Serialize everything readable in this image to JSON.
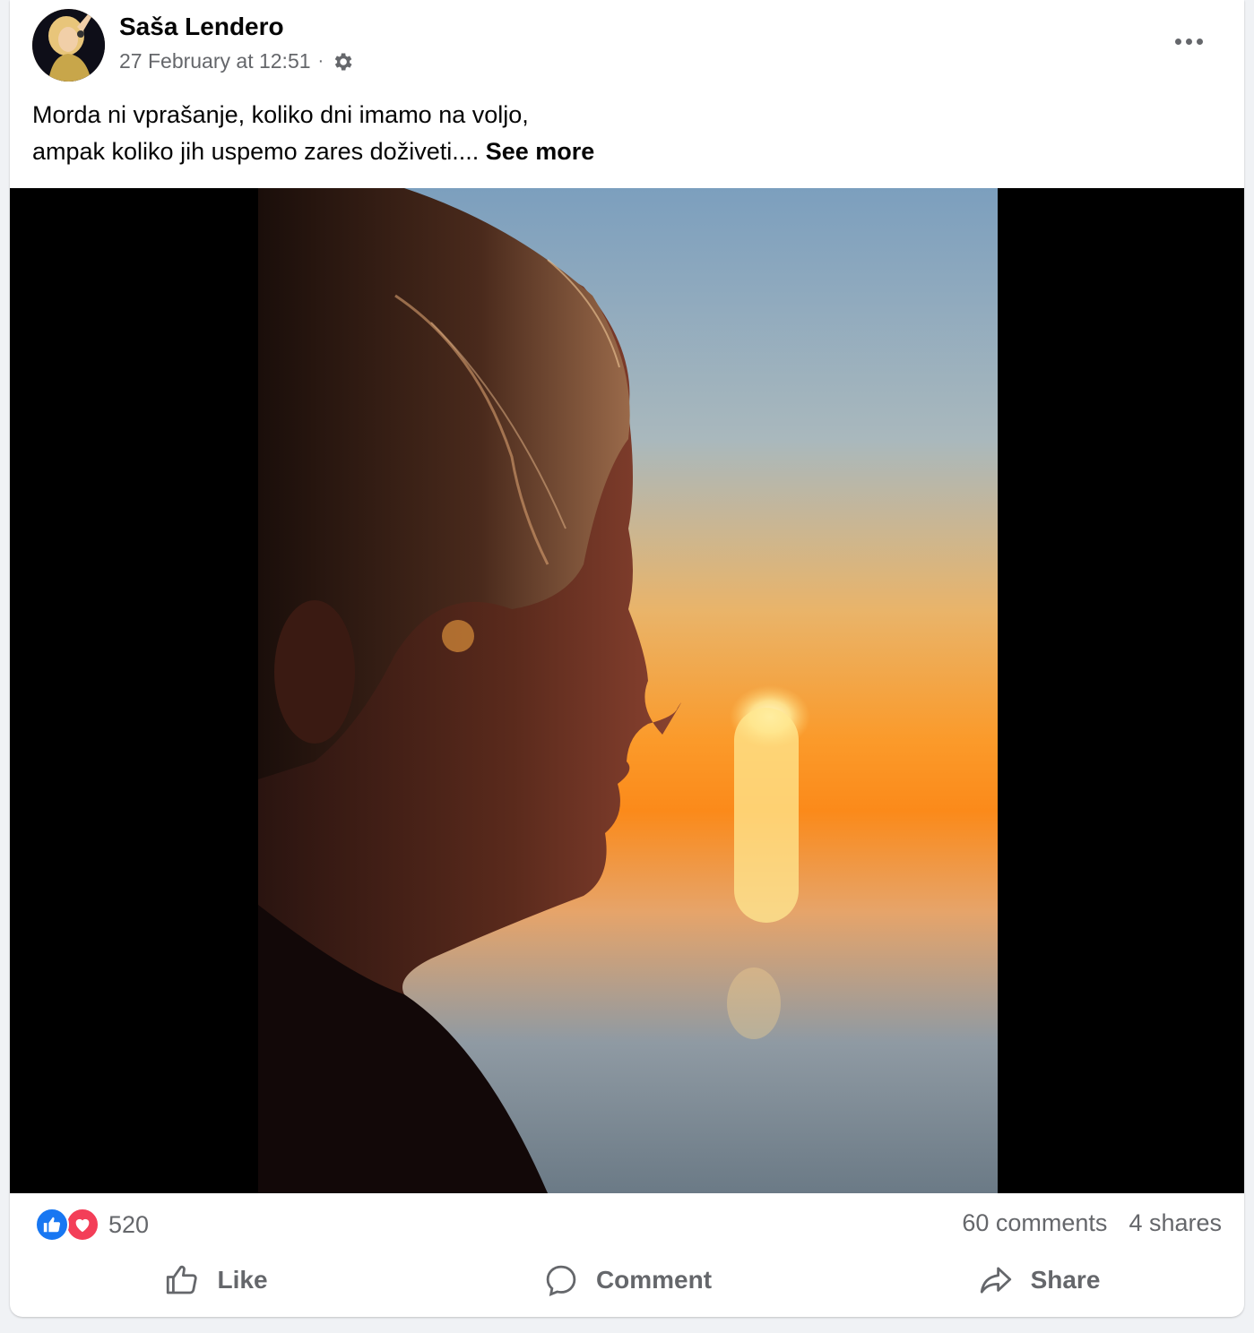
{
  "post": {
    "author": "Saša Lendero",
    "timestamp": "27 February at 12:51",
    "separator": "·",
    "privacy_icon": "gear-icon",
    "text_line1": "Morda ni vprašanje, koliko dni imamo na voljo,",
    "text_line2": "ampak koliko jih uspemo zares doživeti....",
    "see_more": "See more"
  },
  "stats": {
    "reaction_count": "520",
    "reaction_icons": [
      "like-icon",
      "love-icon"
    ],
    "comments": "60 comments",
    "shares": "4 shares"
  },
  "actions": {
    "like": "Like",
    "comment": "Comment",
    "share": "Share"
  },
  "colors": {
    "like_blue": "#1877f2",
    "love_red": "#f33e58",
    "secondary_text": "#65676b"
  }
}
